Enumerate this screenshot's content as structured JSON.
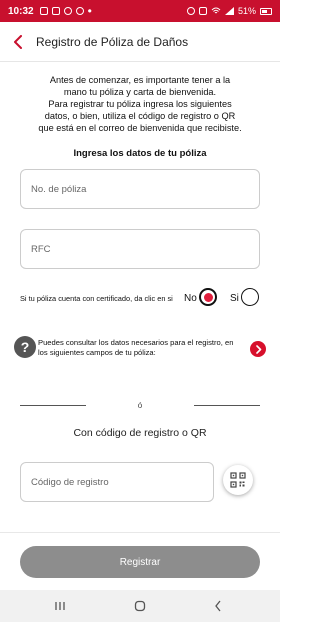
{
  "status_bar": {
    "time": "10:32",
    "battery": "51%",
    "left_icons": [
      "image-icon",
      "image-icon",
      "facebook-icon",
      "whatsapp-icon",
      "dot-icon"
    ],
    "right_icons": [
      "alarm-icon",
      "mute-icon",
      "wifi-icon",
      "signal-icon",
      "battery-icon"
    ],
    "background": "#c8102e"
  },
  "header": {
    "title": "Registro de Póliza de Daños",
    "back_icon": "chevron-left-icon",
    "accent": "#c8102e"
  },
  "intro": {
    "lines": [
      "Antes de comenzar, es importante tener a la",
      "mano tu póliza y carta de bienvenida.",
      "Para registrar tu póliza ingresa los siguientes",
      "datos, o bien, utiliza el código de registro o QR",
      "que está en el correo de bienvenida que recibiste."
    ]
  },
  "form": {
    "section_title": "Ingresa los datos de tu póliza",
    "policy_number": {
      "value": "",
      "placeholder": "No. de póliza"
    },
    "rfc": {
      "value": "",
      "placeholder": "RFC"
    },
    "certificate_question": "Si tu póliza cuenta con certificado, da clic en si",
    "option_no": "No",
    "option_si": "Si",
    "selected_option": "No"
  },
  "info": {
    "icon": "question-icon",
    "lines": [
      "Puedes consultar los datos necesarios para el registro, en",
      "los siguientes campos de tu póliza:"
    ],
    "go_icon": "chevron-right-icon"
  },
  "divider": {
    "text": "ó"
  },
  "registration": {
    "title": "Con código de registro o QR",
    "code": {
      "value": "",
      "placeholder": "Código de registro"
    },
    "qr_icon": "qr-scan-icon"
  },
  "actions": {
    "submit_label": "Registrar",
    "submit_color": "#8d8d8d"
  },
  "nav_bar": {
    "icons": [
      "recents-icon",
      "home-icon",
      "back-icon"
    ]
  }
}
